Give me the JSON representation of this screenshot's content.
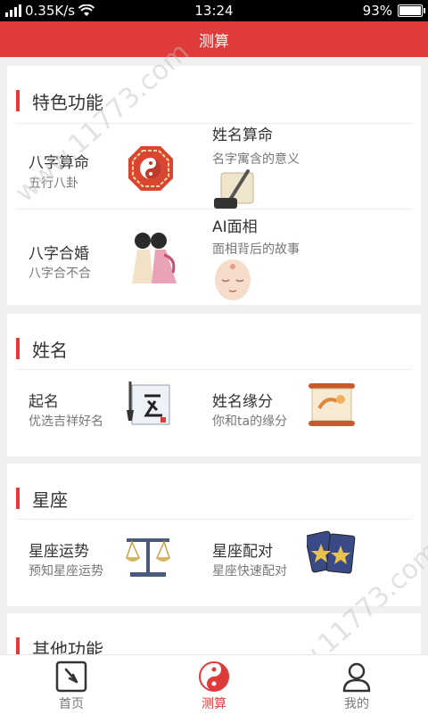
{
  "status_bar": {
    "network": "0.35K/s",
    "time": "13:24",
    "battery": "93%",
    "battery_level": 0.93
  },
  "header": {
    "title": "测算"
  },
  "watermark": {
    "text": "www.11773.com"
  },
  "sections": [
    {
      "title": "特色功能",
      "items": [
        {
          "title": "八字算命",
          "subtitle": "五行八卦",
          "icon": "bagua-icon"
        },
        {
          "title": "姓名算命",
          "subtitle": "名字寓含的意义",
          "icon": "scroll-brush-icon"
        },
        {
          "title": "八字合婚",
          "subtitle": "八字合不合",
          "icon": "couple-icon"
        },
        {
          "title": "AI面相",
          "subtitle": "面相背后的故事",
          "icon": "face-icon"
        }
      ]
    },
    {
      "title": "姓名",
      "items": [
        {
          "title": "起名",
          "subtitle": "优选吉祥好名",
          "icon": "name-brush-icon"
        },
        {
          "title": "姓名缘分",
          "subtitle": "你和ta的缘分",
          "icon": "painting-scroll-icon"
        }
      ]
    },
    {
      "title": "星座",
      "items": [
        {
          "title": "星座运势",
          "subtitle": "预知星座运势",
          "icon": "scales-icon"
        },
        {
          "title": "星座配对",
          "subtitle": "星座快速配对",
          "icon": "tarot-cards-icon"
        }
      ]
    },
    {
      "title": "其他功能",
      "items": []
    }
  ],
  "tabs": [
    {
      "label": "首页",
      "icon": "compass-icon",
      "active": false
    },
    {
      "label": "测算",
      "icon": "yinyang-icon",
      "active": true
    },
    {
      "label": "我的",
      "icon": "user-icon",
      "active": false
    }
  ],
  "colors": {
    "accent": "#e03b3b",
    "background": "#f0f0f0"
  }
}
